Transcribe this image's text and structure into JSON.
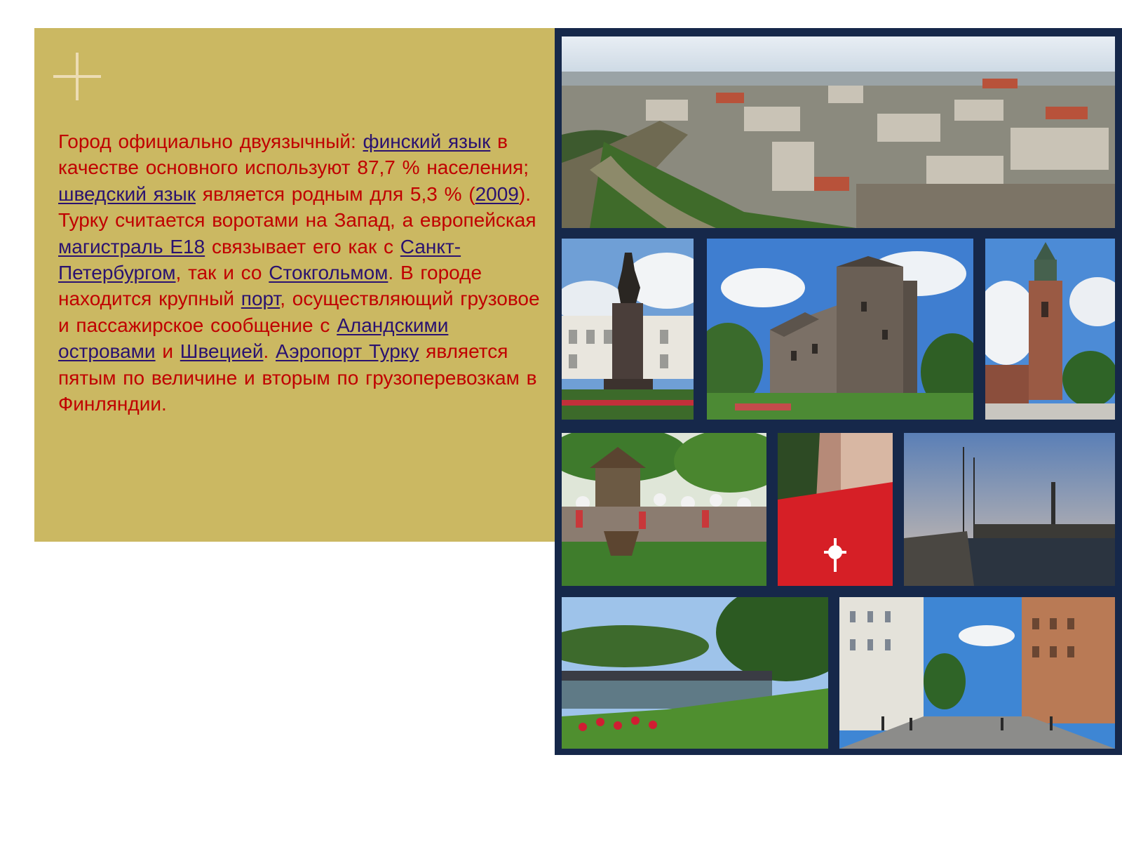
{
  "slide": {
    "decor_icon": "plus-icon",
    "paragraph": [
      {
        "text": "Город официально двуязычный: "
      },
      {
        "text": "финский язык",
        "link": true
      },
      {
        "text": " в качестве основного используют 87,7 % населения; "
      },
      {
        "text": "шведский язык",
        "link": true
      },
      {
        "text": " является родным для 5,3 % ("
      },
      {
        "text": "2009",
        "link": true
      },
      {
        "text": "). Турку считается воротами на Запад, а европейская "
      },
      {
        "text": "магистраль E18",
        "link": true
      },
      {
        "text": " связывает его как с "
      },
      {
        "text": "Санкт-Петербургом",
        "link": true
      },
      {
        "text": ", так и со "
      },
      {
        "text": "Стокгольмом",
        "link": true
      },
      {
        "text": ". В городе находится крупный "
      },
      {
        "text": "порт",
        "link": true
      },
      {
        "text": ", осуществляющий грузовое и пассажирское сообщение с "
      },
      {
        "text": "Аландскими островами",
        "link": true
      },
      {
        "text": " и "
      },
      {
        "text": "Швецией",
        "link": true
      },
      {
        "text": ". "
      },
      {
        "text": "Аэропорт Турку",
        "link": true
      },
      {
        "text": " является пятым по величине и вторым по грузоперевозкам в Финляндии."
      }
    ],
    "colors": {
      "panel": "#cbb862",
      "text": "#c00000",
      "link": "#2a1270",
      "collage_frame": "#16284a"
    }
  },
  "collage": {
    "photos": [
      {
        "name": "photo-city-panorama"
      },
      {
        "name": "photo-statue"
      },
      {
        "name": "photo-turku-castle"
      },
      {
        "name": "photo-cathedral-tower"
      },
      {
        "name": "photo-market-square"
      },
      {
        "name": "photo-red-flag"
      },
      {
        "name": "photo-river-harbor"
      },
      {
        "name": "photo-riverside-park"
      },
      {
        "name": "photo-street"
      }
    ]
  }
}
